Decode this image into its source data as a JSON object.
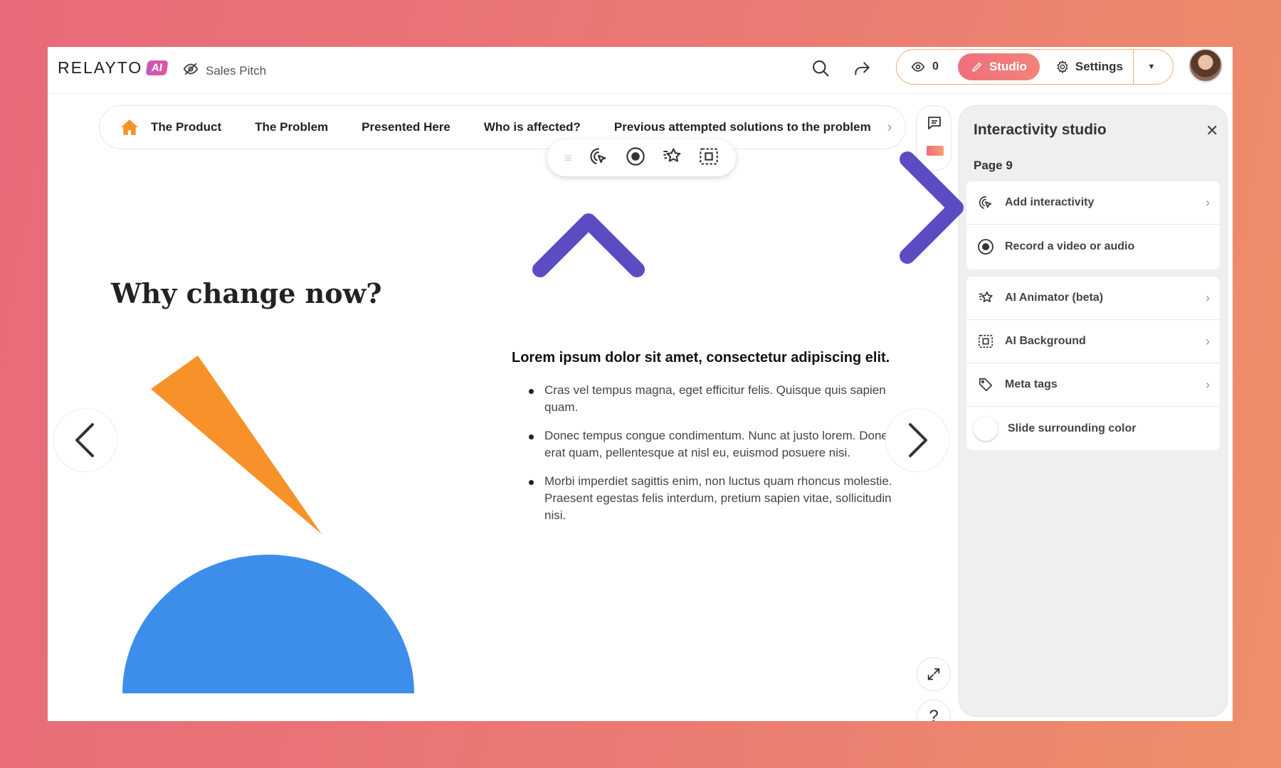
{
  "header": {
    "logo_text": "RELAYTO",
    "logo_badge": "AI",
    "presentation_title": "Sales Pitch",
    "views_count": "0",
    "studio_label": "Studio",
    "settings_label": "Settings"
  },
  "chapters": [
    "The Product",
    "The Problem",
    "Presented Here",
    "Who is affected?",
    "Previous attempted solutions to the problem"
  ],
  "slide": {
    "title": "Why change now?",
    "heading": "Lorem ipsum dolor sit amet, consectetur adipiscing elit.",
    "bullets": [
      "Cras vel tempus magna, eget efficitur felis. Quisque quis sapien quam.",
      "Donec tempus congue condimentum. Nunc at justo lorem. Donec erat quam, pellentesque at nisl eu, euismod posuere nisi.",
      "Morbi imperdiet sagittis enim, non luctus quam rhoncus molestie. Praesent egestas felis interdum, pretium sapien vitae, sollicitudin nisi."
    ],
    "help_label": "?"
  },
  "studio_panel": {
    "title": "Interactivity studio",
    "page_label": "Page 9",
    "rows_a": [
      {
        "label": "Add interactivity",
        "icon": "cursor-click-icon"
      },
      {
        "label": "Record a video or audio",
        "icon": "record-icon"
      }
    ],
    "rows_b": [
      {
        "label": "AI Animator (beta)",
        "icon": "sparkle-star-icon"
      },
      {
        "label": "AI Background",
        "icon": "ai-background-icon"
      },
      {
        "label": "Meta tags",
        "icon": "tags-icon"
      },
      {
        "label": "Slide surrounding color",
        "icon": "toggle"
      }
    ]
  },
  "colors": {
    "accent": "#ef6f7d",
    "orange_shape": "#f7922b",
    "blue_shape": "#3d8eea",
    "arrow_purple": "#5b4cc4",
    "arrow_pink": "#f47d96"
  }
}
